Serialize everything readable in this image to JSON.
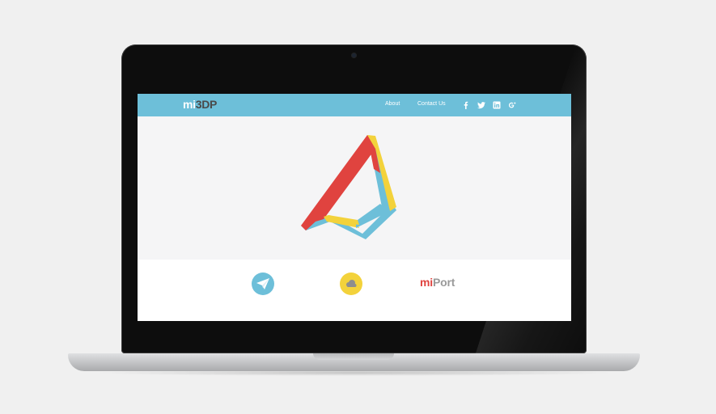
{
  "site": {
    "logo_prefix": "mi",
    "logo_accent": "3DP",
    "nav": {
      "about": "About",
      "contact": "Contact Us"
    },
    "social_icons": [
      "facebook-icon",
      "twitter-icon",
      "linkedin-icon",
      "google-plus-icon"
    ],
    "colors": {
      "header_blue": "#6dbfd9",
      "red": "#e0433f",
      "yellow": "#f3d23b",
      "gray": "#9a9a9a"
    }
  },
  "features": {
    "icons": [
      "paper-plane-icon",
      "cloud-icon"
    ],
    "brand_prefix": "mi",
    "brand_suffix": "Port"
  }
}
